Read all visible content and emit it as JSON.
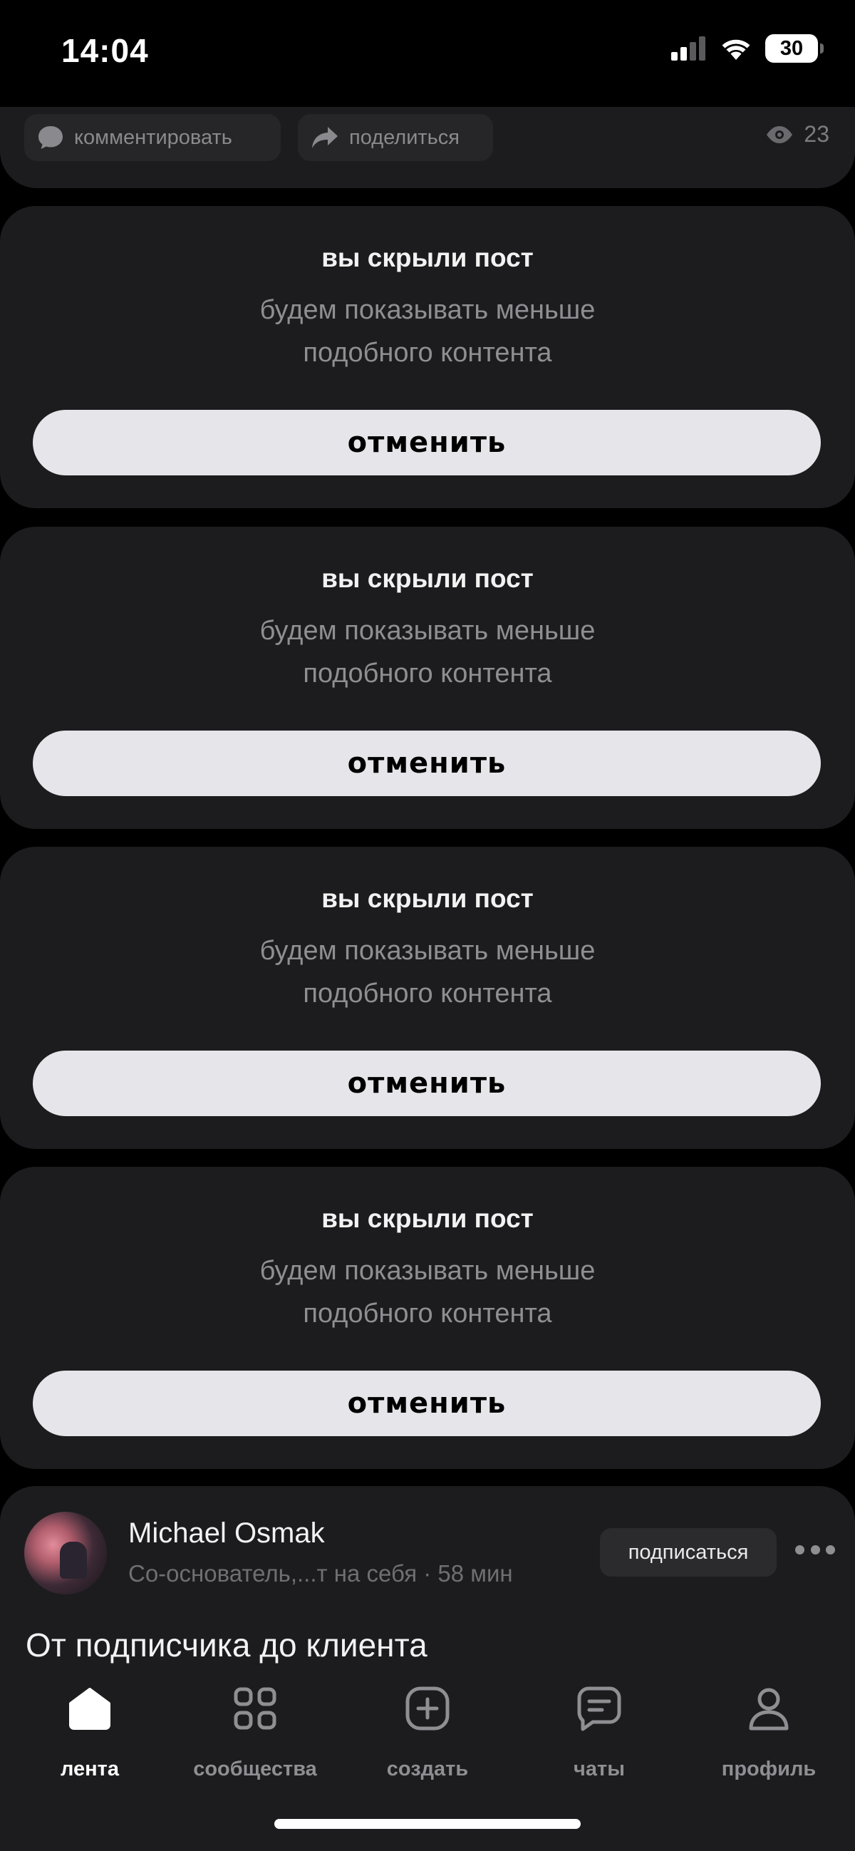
{
  "status_bar": {
    "time": "14:04",
    "battery": "30"
  },
  "top_card": {
    "comment_label": "комментировать",
    "share_label": "поделиться",
    "views": "23"
  },
  "hidden_posts": [
    {
      "title": "вы скрыли пост",
      "line1": "будем показывать меньше",
      "line2": "подобного контента",
      "undo": "отменить"
    },
    {
      "title": "вы скрыли пост",
      "line1": "будем показывать меньше",
      "line2": "подобного контента",
      "undo": "отменить"
    },
    {
      "title": "вы скрыли пост",
      "line1": "будем показывать меньше",
      "line2": "подобного контента",
      "undo": "отменить"
    },
    {
      "title": "вы скрыли пост",
      "line1": "будем показывать меньше",
      "line2": "подобного контента",
      "undo": "отменить"
    }
  ],
  "post": {
    "author": "Michael Osmak",
    "meta": "Со-основатель,...т на себя · 58 мин",
    "subscribe": "подписаться",
    "title": "От подписчика до клиента"
  },
  "nav": {
    "items": [
      {
        "label": "лента",
        "icon": "home-icon",
        "active": true
      },
      {
        "label": "сообщества",
        "icon": "grid-icon",
        "active": false
      },
      {
        "label": "создать",
        "icon": "plus-square-icon",
        "active": false
      },
      {
        "label": "чаты",
        "icon": "chat-icon",
        "active": false
      },
      {
        "label": "профиль",
        "icon": "person-icon",
        "active": false
      }
    ]
  },
  "colors": {
    "background": "#000000",
    "card": "#1c1c1e",
    "button": "#e5e5ea",
    "muted_text": "#8e8e93"
  }
}
